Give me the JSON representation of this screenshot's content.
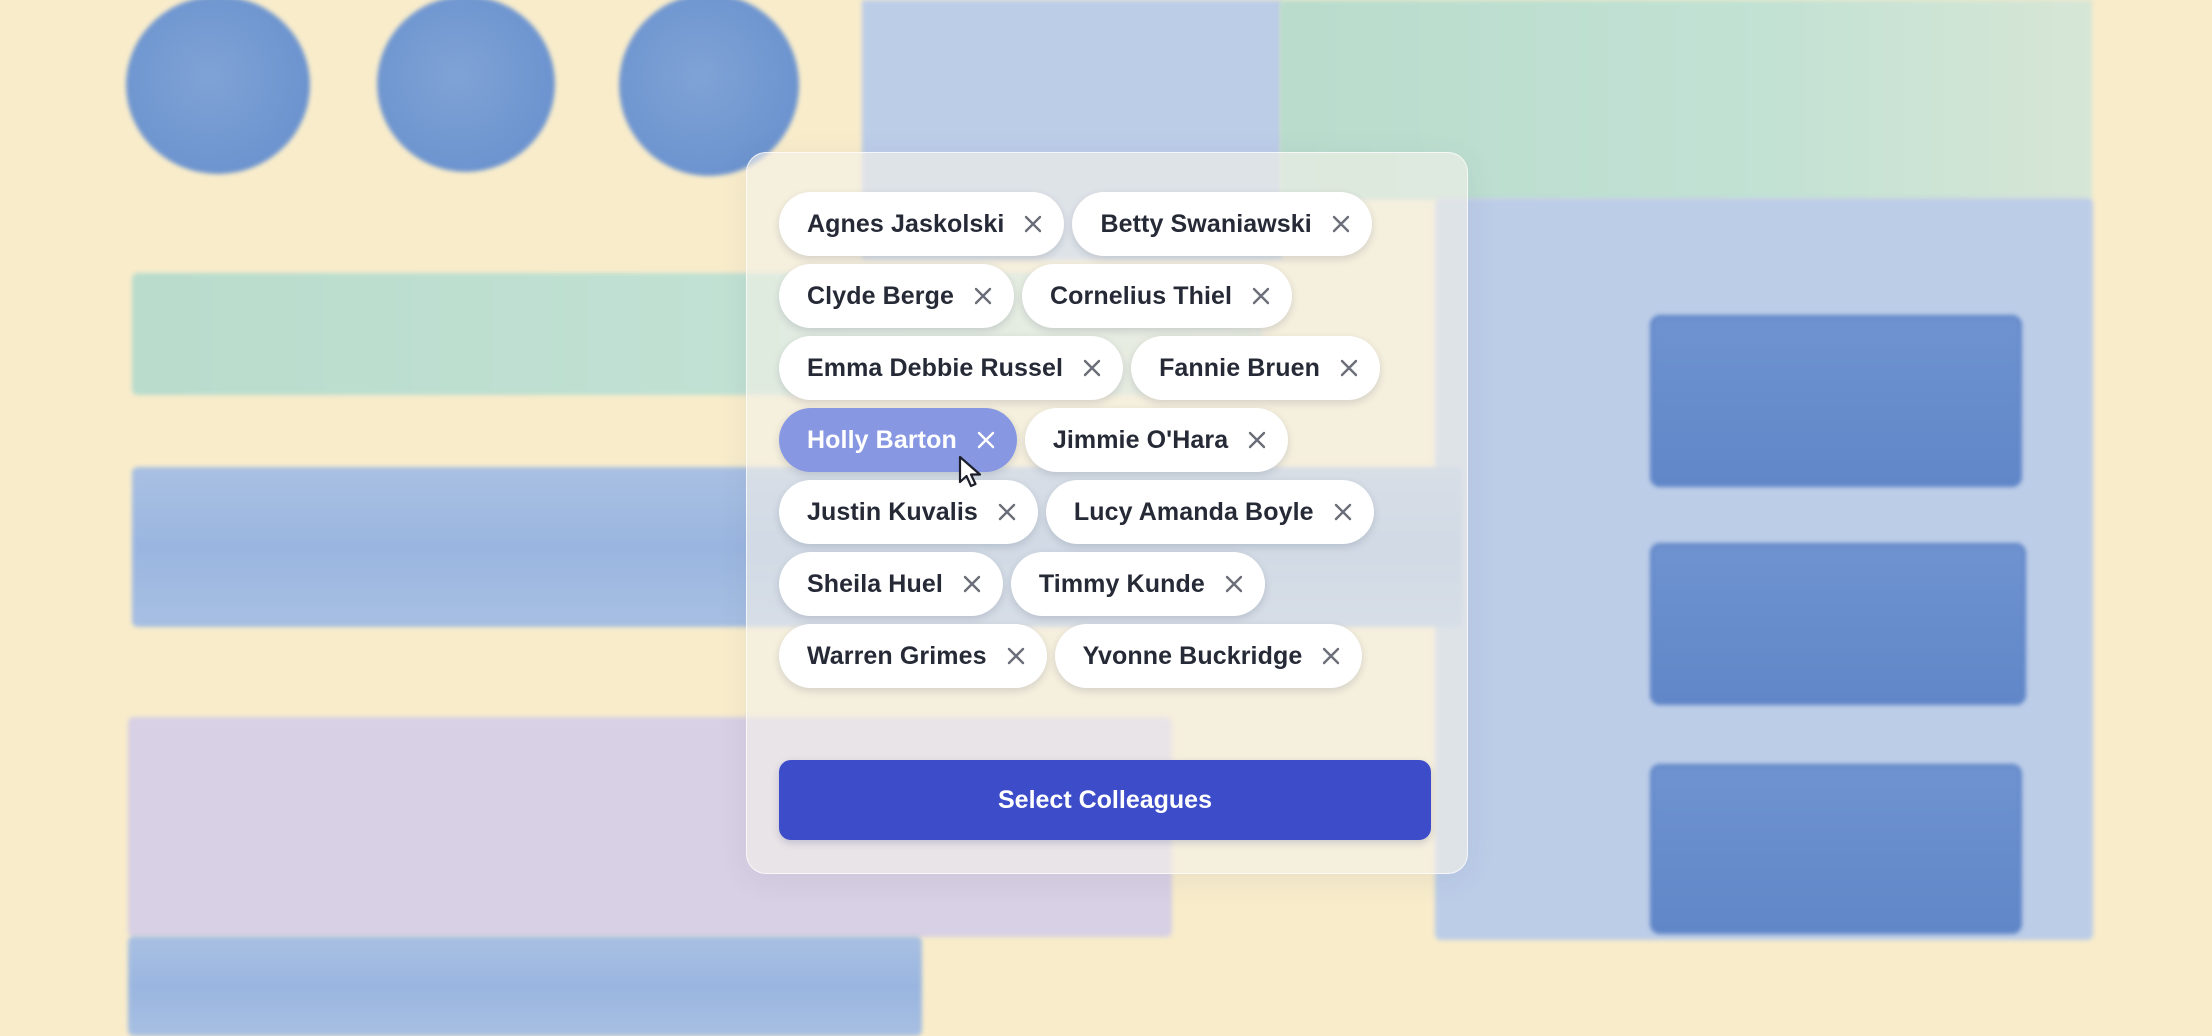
{
  "chips": [
    {
      "label": "Agnes Jaskolski",
      "active": false
    },
    {
      "label": "Betty Swaniawski",
      "active": false
    },
    {
      "label": "Clyde Berge",
      "active": false
    },
    {
      "label": "Cornelius Thiel",
      "active": false
    },
    {
      "label": "Emma Debbie Russel",
      "active": false
    },
    {
      "label": "Fannie Bruen",
      "active": false
    },
    {
      "label": "Holly Barton",
      "active": true
    },
    {
      "label": "Jimmie O'Hara",
      "active": false
    },
    {
      "label": "Justin Kuvalis",
      "active": false
    },
    {
      "label": "Lucy Amanda Boyle",
      "active": false
    },
    {
      "label": "Sheila Huel",
      "active": false
    },
    {
      "label": "Timmy Kunde",
      "active": false
    },
    {
      "label": "Warren Grimes",
      "active": false
    },
    {
      "label": "Yvonne Buckridge",
      "active": false
    }
  ],
  "button": {
    "label": "Select Colleagues"
  },
  "colors": {
    "accent": "#3d4cc9",
    "chip_active": "#8797e2",
    "background": "#f8eccb"
  },
  "icons": {
    "chip_remove": "close-icon",
    "pointer": "mouse-cursor-icon"
  }
}
